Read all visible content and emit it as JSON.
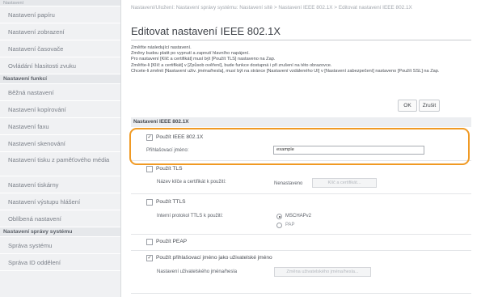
{
  "sidebar": {
    "top_label": "Nastavení",
    "items": [
      {
        "label": "Nastavení papíru",
        "type": "item"
      },
      {
        "label": "Nastavení zobrazení",
        "type": "item"
      },
      {
        "label": "Nastavení časovače",
        "type": "item"
      },
      {
        "label": "Ovládání hlasitosti zvuku",
        "type": "item"
      },
      {
        "label": "Nastavení funkcí",
        "type": "header"
      },
      {
        "label": "Běžná nastavení",
        "type": "item"
      },
      {
        "label": "Nastavení kopírování",
        "type": "item"
      },
      {
        "label": "Nastavení faxu",
        "type": "item"
      },
      {
        "label": "Nastavení skenování",
        "type": "item"
      },
      {
        "label": "Nastavení tisku z paměťového média",
        "type": "double"
      },
      {
        "label": "Nastavení tiskárny",
        "type": "item"
      },
      {
        "label": "Nastavení výstupu hlášení",
        "type": "item"
      },
      {
        "label": "Oblíbená nastavení",
        "type": "item"
      },
      {
        "label": "Nastavení správy systému",
        "type": "header"
      },
      {
        "label": "Správa systému",
        "type": "item"
      },
      {
        "label": "Správa ID oddělení",
        "type": "item"
      }
    ]
  },
  "breadcrumb": "Nastavení/Uložení: Nastavení správy systému: Nastavení sítě > Nastavení IEEE 802.1X > Editovat nastavení IEEE 802.1X",
  "page_title": "Editovat nastavení IEEE 802.1X",
  "notes": [
    "Změňte následující nastavení.",
    "Změny budou platit po vypnutí a zapnutí hlavního napájení.",
    "Pro nastavení [Klíč a certifikát] musí být [Použít TLS] nastaveno na Zap.",
    "Změňte-li [Klíč a certifikát] v [Způsob ověření], bude funkce dostupná i při zrušení na této obrazovce.",
    "Chcete-li změnit [Nastavení uživ. jména/hesla], musí být na stránce [Nastavení vzdáleného UI] v [Nastavení zabezpečení] nastaveno [Použít SSL] na Zap."
  ],
  "buttons": {
    "ok": "OK",
    "cancel": "Zrušit"
  },
  "section_title": "Nastavení IEEE 802.1X",
  "form": {
    "use_ieee": {
      "label": "Použít IEEE 802.1X",
      "checked": true
    },
    "login_name": {
      "label": "Přihlašovací jméno:",
      "value": "example"
    },
    "use_tls": {
      "label": "Použít TLS",
      "checked": false
    },
    "key_cert": {
      "label": "Název klíče a certifikát k použití:",
      "status": "Nenastaveno",
      "button": "Klíč a certifikát..."
    },
    "use_ttls": {
      "label": "Použít TTLS",
      "checked": false
    },
    "ttls_protocol": {
      "label": "Interní protokol TTLS k použití:",
      "options": [
        "MSCHAPv2",
        "PAP"
      ],
      "selected": "MSCHAPv2"
    },
    "use_peap": {
      "label": "Použít PEAP",
      "checked": false
    },
    "use_login_as_user": {
      "label": "Použít přihlašovací jméno jako uživatelské jméno",
      "checked": true
    },
    "user_pass": {
      "label": "Nastavení uživatelského jména/hesla",
      "button": "Změna uživatelského jména/hesla..."
    }
  },
  "colors": {
    "highlight": "#f09a24",
    "sidebar_bg": "#f0f1f3"
  }
}
